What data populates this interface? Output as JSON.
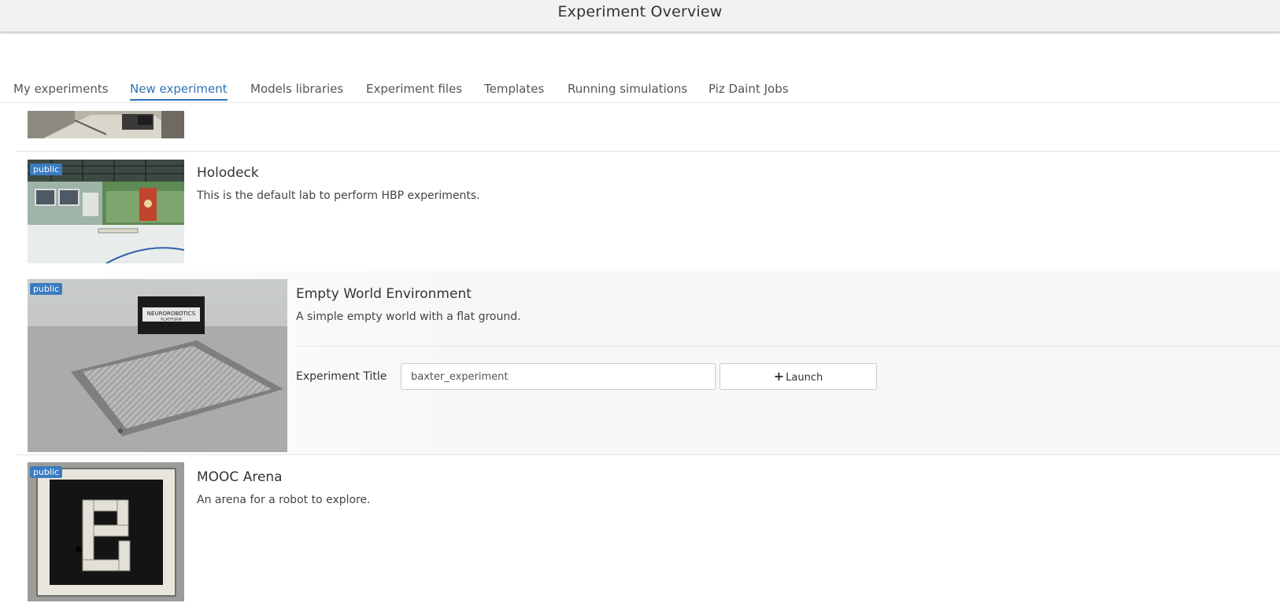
{
  "header": {
    "title": "Experiment Overview"
  },
  "tabs": [
    {
      "label": "My experiments",
      "active": false
    },
    {
      "label": "New experiment",
      "active": true
    },
    {
      "label": "Models libraries",
      "active": false
    },
    {
      "label": "Experiment files",
      "active": false
    },
    {
      "label": "Templates",
      "active": false
    },
    {
      "label": "Running simulations",
      "active": false
    },
    {
      "label": "Piz Daint Jobs",
      "active": false
    }
  ],
  "experiments": [
    {
      "title": "Holodeck",
      "description": "This is the default lab to perform HBP experiments.",
      "badge": "public"
    },
    {
      "title": "Empty World Environment",
      "description": "A simple empty world with a flat ground.",
      "badge": "public",
      "sign_text_1": "NEUROROBOTICS",
      "sign_text_2": "PLATFORM",
      "launch_form": {
        "label": "Experiment Title",
        "value": "baxter_experiment",
        "button_label": "Launch",
        "button_icon": "plus-icon"
      }
    },
    {
      "title": "MOOC Arena",
      "description": "An arena for a robot to explore.",
      "badge": "public"
    }
  ],
  "colors": {
    "accent": "#2f73b6",
    "badge": "#3a7cc1",
    "header_bg": "#f2f2f2"
  }
}
